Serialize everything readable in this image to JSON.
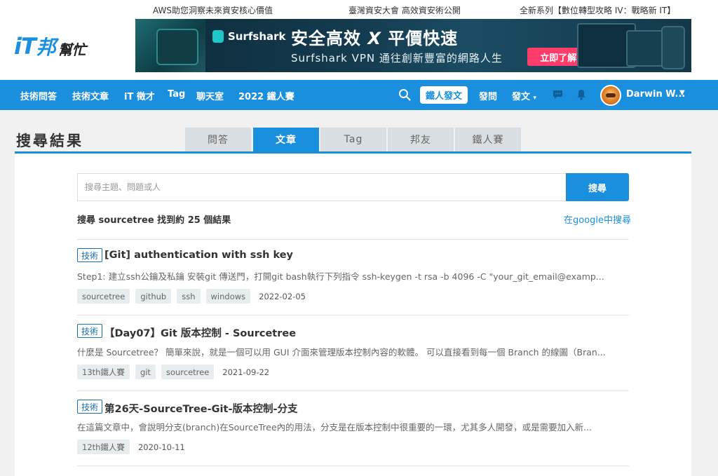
{
  "promo": {
    "link1": "AWS助您洞察未來資安核心價值",
    "link2": "臺灣資安大會 高效資安術公開",
    "link3": "全新系列【數位轉型攻略 IV：戰略新 IT】"
  },
  "logo": {
    "it": "iT",
    "bang": "邦",
    "help": "幫忙"
  },
  "banner": {
    "brand": "Surfshark",
    "headline_a": "安全高效 ",
    "headline_x": "X",
    "headline_b": " 平價快速",
    "sub": "Surfshark VPN 通往創新豐富的網路人生",
    "cta": "立即了解 →"
  },
  "nav": {
    "items": [
      "技術問答",
      "技術文章",
      "iT 徵才",
      "Tag",
      "聊天室",
      "2022 鐵人賽"
    ],
    "post_label": "鐵人發文",
    "ask": "發問",
    "write": "發文",
    "user": "Darwin W...",
    "icons": [
      "search-icon",
      "chat-icon",
      "bell-icon"
    ],
    "accent": "#1a8fdd"
  },
  "page": {
    "title": "搜尋結果",
    "tabs": [
      "問答",
      "文章",
      "Tag",
      "邦友",
      "鐵人賽"
    ],
    "active_tab": "文章"
  },
  "search": {
    "placeholder": "搜尋主題、問題或人",
    "button": "搜尋",
    "summary": "搜尋 sourcetree 找到約 25 個結果",
    "google_link": "在google中搜尋"
  },
  "results": [
    {
      "badge": "技術",
      "title": "[Git] authentication with ssh key",
      "snippet": "Step1: 建立ssh公鑰及私鑰 安裝git 傳送門，打開git bash執行下列指令 ssh-keygen -t rsa -b 4096 -C \"your_git_email@examp...",
      "tags": [
        "sourcetree",
        "github",
        "ssh",
        "windows"
      ],
      "date": "2022-02-05"
    },
    {
      "badge": "技術",
      "title": "【Day07】Git 版本控制 - Sourcetree",
      "snippet": "什麼是 Sourcetree？ 簡單來說，就是一個可以用 GUI 介面來管理版本控制內容的軟體。 可以直接看到每一個 Branch 的線圖（Bran...",
      "tags": [
        "13th鐵人賽",
        "git",
        "sourcetree"
      ],
      "date": "2021-09-22"
    },
    {
      "badge": "技術",
      "title": "第26天-SourceTree-Git-版本控制-分支",
      "snippet": "在這篇文章中，會說明分支(branch)在SourceTree內的用法，分支是在版本控制中很重要的一環，尤其多人開發，或是需要加入新...",
      "tags": [
        "12th鐵人賽"
      ],
      "date": "2020-10-11"
    }
  ]
}
